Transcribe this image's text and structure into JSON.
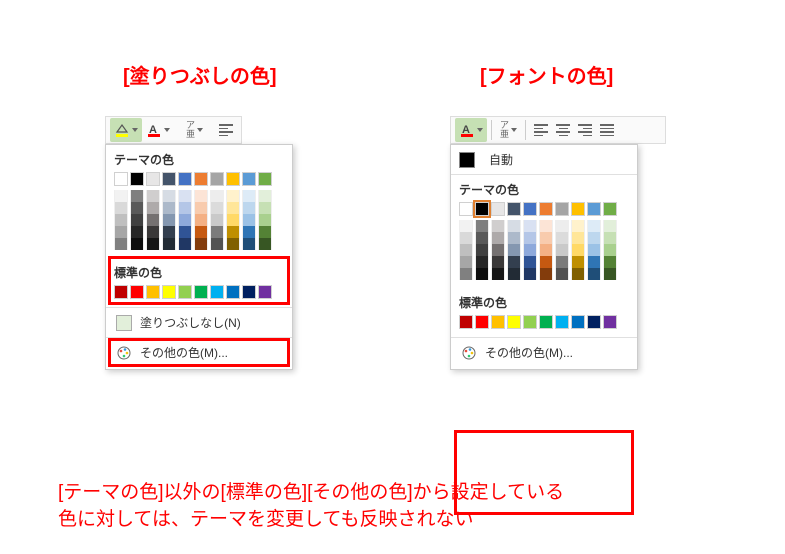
{
  "titles": {
    "fill": "[塗りつぶしの色]",
    "font": "[フォントの色]"
  },
  "labels": {
    "themeColors": "テーマの色",
    "standardColors": "標準の色",
    "auto": "自動",
    "noFill": "塗りつぶしなし(N)",
    "moreColors": "その他の色(M)...",
    "rubyTop": "ア",
    "rubyBottom": "亜"
  },
  "themeRow": [
    "#ffffff",
    "#000000",
    "#e7e6e6",
    "#44546a",
    "#4472c4",
    "#ed7d31",
    "#a5a5a5",
    "#ffc000",
    "#5b9bd5",
    "#70ad47"
  ],
  "tints": [
    [
      "#f2f2f2",
      "#7f7f7f",
      "#d0cece",
      "#d6dce4",
      "#d9e1f2",
      "#fce4d6",
      "#ededed",
      "#fff2cc",
      "#ddebf7",
      "#e2efda"
    ],
    [
      "#d9d9d9",
      "#595959",
      "#aeaaaa",
      "#acb9ca",
      "#b4c6e7",
      "#f8cbad",
      "#dbdbdb",
      "#ffe699",
      "#bdd7ee",
      "#c6e0b4"
    ],
    [
      "#bfbfbf",
      "#404040",
      "#757171",
      "#8497b0",
      "#8ea9db",
      "#f4b084",
      "#c9c9c9",
      "#ffd966",
      "#9bc2e6",
      "#a9d08e"
    ],
    [
      "#a6a6a6",
      "#262626",
      "#3a3838",
      "#333f4f",
      "#305496",
      "#c65911",
      "#7b7b7b",
      "#bf8f00",
      "#2f75b5",
      "#548235"
    ],
    [
      "#808080",
      "#0d0d0d",
      "#161616",
      "#222b35",
      "#203764",
      "#833c0c",
      "#525252",
      "#806000",
      "#1f4e78",
      "#375623"
    ]
  ],
  "standardColors": [
    "#c00000",
    "#ff0000",
    "#ffc000",
    "#ffff00",
    "#92d050",
    "#00b050",
    "#00b0f0",
    "#0070c0",
    "#002060",
    "#7030a0"
  ],
  "footer": {
    "line1": "[テーマの色]以外の[標準の色][その他の色]から設定している",
    "line2": "色に対しては、テーマを変更しても反映されない"
  }
}
